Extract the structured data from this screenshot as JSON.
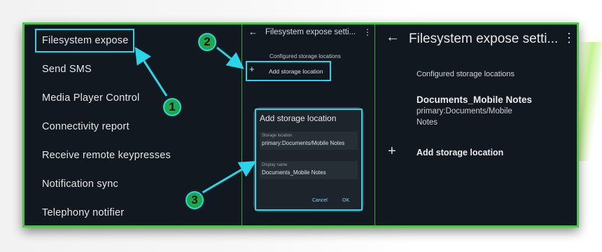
{
  "panel1": {
    "items": [
      "Filesystem expose",
      "Send SMS",
      "Media Player Control",
      "Connectivity report",
      "Receive remote keypresses",
      "Notification sync",
      "Telephony notifier"
    ]
  },
  "panel2": {
    "title": "Filesystem expose setti...",
    "section_label": "Configured storage locations",
    "add_label": "Add storage location",
    "dialog": {
      "title": "Add storage location",
      "storage_label": "Storage location",
      "storage_value": "primary:Documents/Mobile Notes",
      "display_label": "Display name",
      "display_value": "Documents_Mobile Notes",
      "cancel": "Cancel",
      "ok": "OK"
    }
  },
  "panel3": {
    "title": "Filesystem expose setti...",
    "section_label": "Configured storage locations",
    "entry_name": "Documents_Mobile Notes",
    "entry_path_line1": "primary:Documents/Mobile",
    "entry_path_line2": "Notes",
    "add_label": "Add storage location"
  },
  "steps": [
    "1",
    "2",
    "3"
  ],
  "colors": {
    "highlight": "#27d6e8",
    "badge": "#1ea84a",
    "frame": "#4ec44a"
  }
}
